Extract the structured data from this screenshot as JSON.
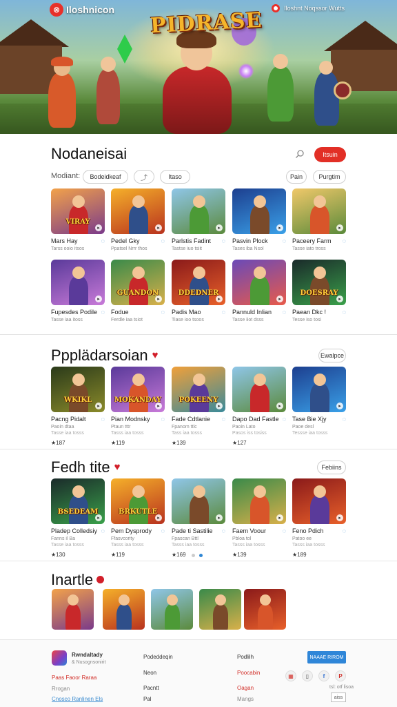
{
  "colors": {
    "accent_red": "#e22f26",
    "accent_blue": "#2f86d8",
    "title_gold": "#f5b52b"
  },
  "hero": {
    "logo_text": "Iloshnicon",
    "logo_icon": "app-logo-icon",
    "title": "PIDRASE",
    "top_right_text": "Iloshnt Noqssor Wutts"
  },
  "section1": {
    "title": "Nodaneisai",
    "button_label": "Itsuin",
    "filter_label": "Modiant:",
    "pills_left": [
      "Bodeidkeaf",
      "Itaso"
    ],
    "pills_right": [
      "Pain",
      "Purgtim"
    ],
    "cards": [
      {
        "name": "Mars Hay",
        "sub": "Tarss ooio itsos",
        "thumb_text": "VIRAY",
        "theme": "sunset"
      },
      {
        "name": "Pedel Gky",
        "sub": "Ppatsel Nrrr thos",
        "thumb_text": "",
        "theme": "fire"
      },
      {
        "name": "Parlstis Fadint",
        "sub": "Tastse iuo tsiit",
        "thumb_text": "",
        "theme": "sky"
      },
      {
        "name": "Pasvin Plock",
        "sub": "Tases iba Nsol",
        "thumb_text": "",
        "theme": "blue"
      },
      {
        "name": "Paceery Farm",
        "sub": "Tasse iato tross",
        "thumb_text": "",
        "theme": "gold"
      },
      {
        "name": "Fupesdes Podile",
        "sub": "Tasse iaa itoss",
        "thumb_text": "",
        "theme": "purple"
      },
      {
        "name": "Fodue",
        "sub": "Ferdle iaa tsiot",
        "thumb_text": "GUANDON",
        "theme": "green"
      },
      {
        "name": "Padis Mao",
        "sub": "Tiase ioo tsoos",
        "thumb_text": "DDEDNER",
        "theme": "red"
      },
      {
        "name": "Pannuld Inlian",
        "sub": "Tasse iiot dsss",
        "thumb_text": "",
        "theme": "purple2"
      },
      {
        "name": "Paean Dkc !",
        "sub": "Tesse iso tosi",
        "thumb_text": "DOESRAY",
        "theme": "dark"
      }
    ]
  },
  "section2": {
    "title": "Ppplädarsoian",
    "pill": "Ewalpce",
    "cards": [
      {
        "name": "Pacng Pidalt",
        "sub": "Paoin dtaa",
        "sub2": "Tasse iaa tosss",
        "rating": "★187",
        "thumb_text": "WKIKL",
        "theme": "olive"
      },
      {
        "name": "Pian Modnsky",
        "sub": "Ptaun tttr",
        "sub2": "Tasss iaa tosss",
        "rating": "★119",
        "thumb_text": "MOKANDAY",
        "theme": "purple"
      },
      {
        "name": "Fade Cdtlanie",
        "sub": "Fpanom ttlc",
        "sub2": "Tass iaa tosss",
        "rating": "★139",
        "thumb_text": "POKEENY",
        "theme": "warm"
      },
      {
        "name": "Dapo Dad Fastle",
        "sub": "Paoin Lato",
        "sub2": "Pasos iss tosiss",
        "rating": "★127",
        "thumb_text": "",
        "theme": "sky"
      },
      {
        "name": "Tase Bie Xjy",
        "sub": "Paoe desl",
        "sub2": "Tessse iaa tosss",
        "rating": "",
        "thumb_text": "",
        "theme": "blue"
      }
    ]
  },
  "section3": {
    "title": "Fedh tite",
    "pill": "Febiins",
    "cards": [
      {
        "name": "Pladep Colledsiy",
        "sub": "Fanns il Ba",
        "sub2": "Tasse iaa tosss",
        "rating": "★130",
        "thumb_text": "BSEDEAM",
        "theme": "dark"
      },
      {
        "name": "Pem Dysprody",
        "sub": "Ffasvcority",
        "sub2": "Tasss iaa tosss",
        "rating": "★119",
        "thumb_text": "BRKUTLE",
        "theme": "fire"
      },
      {
        "name": "Pade ti Sastilie",
        "sub": "Fpascan Bttl",
        "sub2": "Tasss iaa tosss",
        "rating": "★169",
        "thumb_text": "",
        "theme": "sky"
      },
      {
        "name": "Faem Voour",
        "sub": "Pbloa tol",
        "sub2": "Tasss iaa tosss",
        "rating": "★139",
        "thumb_text": "",
        "theme": "green"
      },
      {
        "name": "Feno Pdich",
        "sub": "Patoo ee",
        "sub2": "Tasss iaa tosss",
        "rating": "★189",
        "thumb_text": "",
        "theme": "red"
      }
    ]
  },
  "section4": {
    "title": "Inartle",
    "minis": [
      "sunset",
      "fire",
      "sky",
      "green",
      "red"
    ]
  },
  "footer": {
    "app_name": "Rwndaltady",
    "app_sub": "& Nusognsonirit",
    "link_red": "Paas Faoor Raraa",
    "link_gray": "Rrogan",
    "link_blue": "Cnosco Ranlinen Els",
    "col2": [
      "Podeddeqin",
      "Neon",
      "Pacntt",
      "Pal"
    ],
    "col3_title": "Podlilh",
    "col3": [
      "Poocabin",
      "Oagan",
      "Mangs"
    ],
    "button": "NAAAE RIROM",
    "social_icons": [
      "grid-icon",
      "phone-icon",
      "facebook-icon",
      "pinterest-icon"
    ],
    "right_small": "tsl: otf lisoa",
    "box_label": "aiss"
  }
}
